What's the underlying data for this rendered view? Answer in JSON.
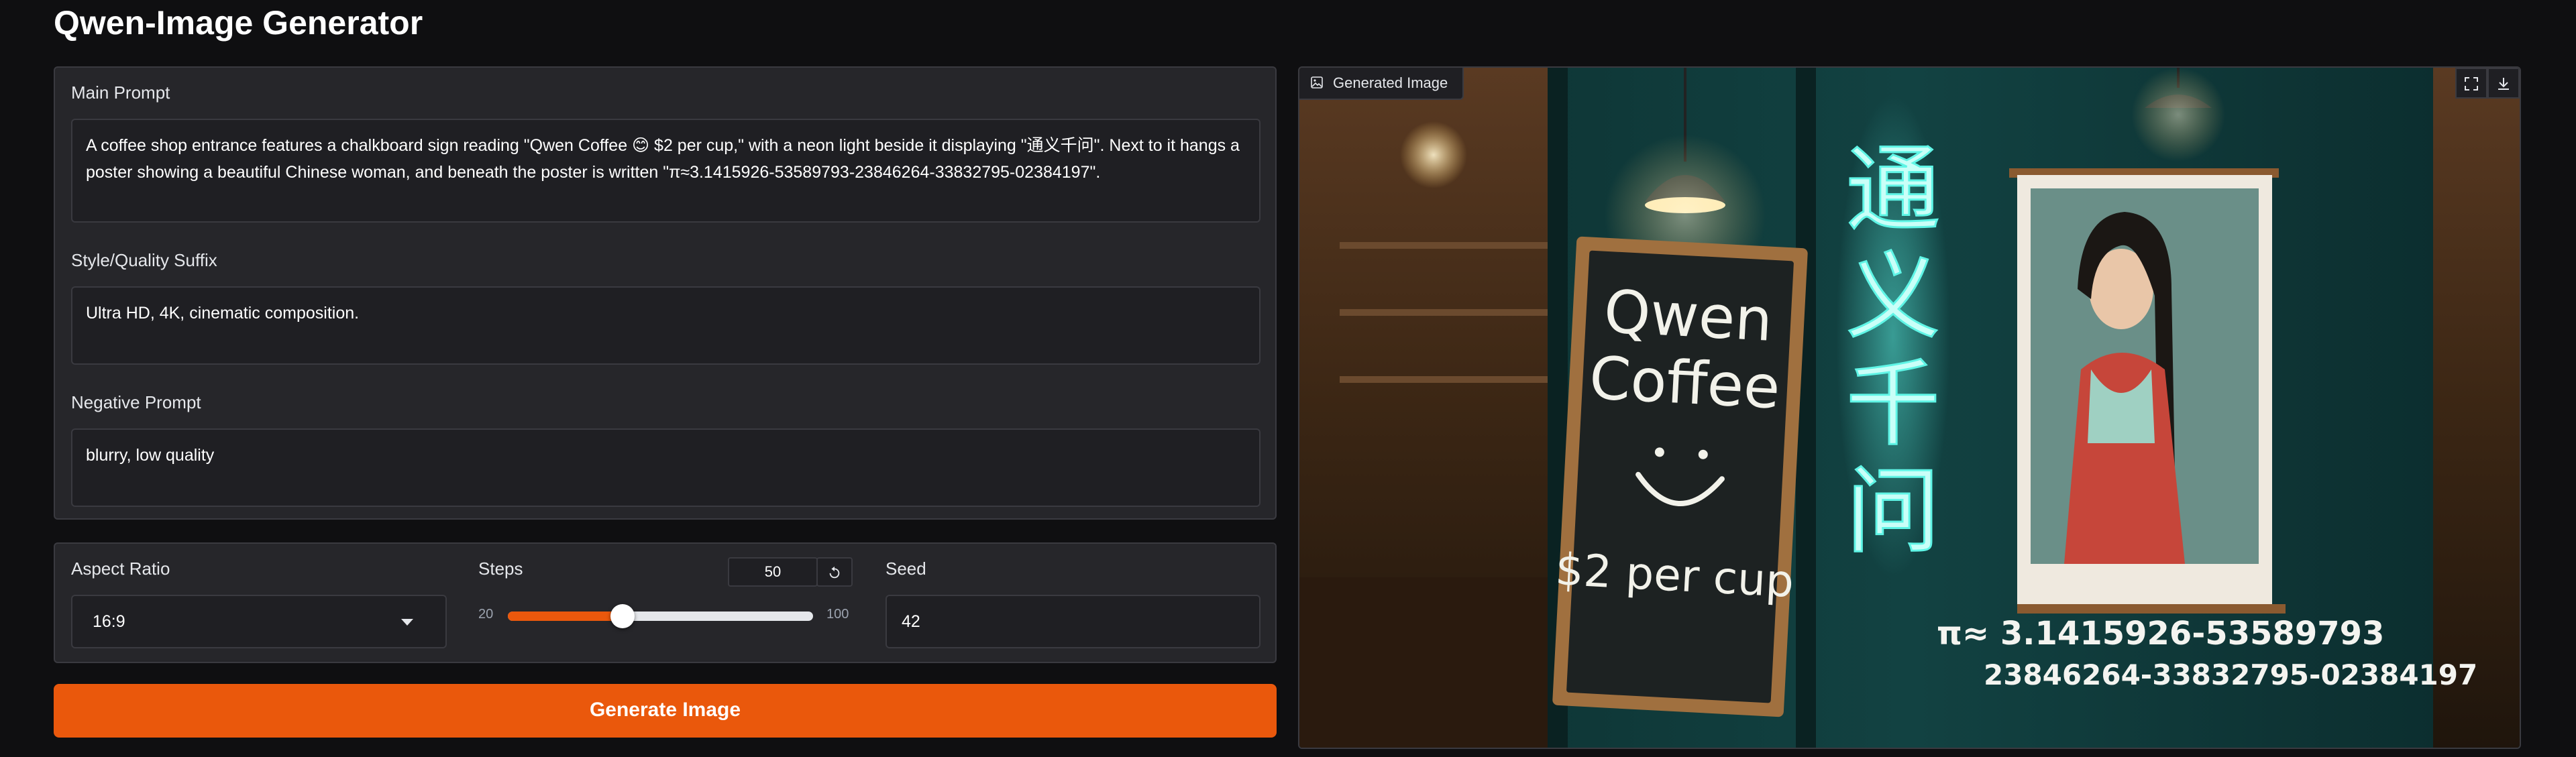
{
  "app": {
    "title": "Qwen-Image Generator"
  },
  "main_prompt": {
    "label": "Main Prompt",
    "value": "A coffee shop entrance features a chalkboard sign reading \"Qwen Coffee 😊 $2 per cup,\" with a neon light beside it displaying \"通义千问\". Next to it hangs a poster showing a beautiful Chinese woman, and beneath the poster is written \"π≈3.1415926-53589793-23846264-33832795-02384197\"."
  },
  "style_suffix": {
    "label": "Style/Quality Suffix",
    "value": "Ultra HD, 4K, cinematic composition."
  },
  "negative_prompt": {
    "label": "Negative Prompt",
    "value": "blurry, low quality"
  },
  "aspect_ratio": {
    "label": "Aspect Ratio",
    "value": "16:9"
  },
  "steps": {
    "label": "Steps",
    "value": 50,
    "value_text": "50",
    "min": 20,
    "min_text": "20",
    "max": 100,
    "max_text": "100",
    "reset_icon": "reset-icon"
  },
  "seed": {
    "label": "Seed",
    "value": "42"
  },
  "generate_button": {
    "label": "Generate Image"
  },
  "output": {
    "label": "Generated Image",
    "tag_icon": "image-icon",
    "tools": [
      "fullscreen-icon",
      "download-icon"
    ],
    "scene": {
      "chalkboard_lines": [
        "Qwen",
        "Coffee",
        "$2 per cup"
      ],
      "neon_text": [
        "通",
        "义",
        "千",
        "问"
      ],
      "pi_lines": [
        "π≈ 3.1415926-53589793",
        "23846264-33832795-02384197"
      ]
    }
  },
  "colors": {
    "accent": "#ea580c",
    "background": "#0f0f11",
    "panel": "#26262a",
    "neon": "#5ff5e6"
  }
}
